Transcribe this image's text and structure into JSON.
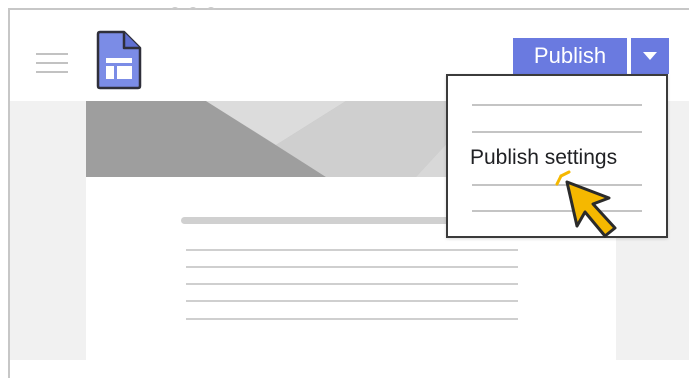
{
  "toolbar": {
    "publish_label": "Publish",
    "menu_icon": "hamburger-menu-icon",
    "doc_icon": "sites-document-icon",
    "dropdown_icon": "caret-down-icon"
  },
  "publish_menu": {
    "items": [
      {
        "label": "Publish settings"
      }
    ]
  },
  "colors": {
    "accent": "#6a7ae0",
    "doc_icon_fill": "#7b8ce6",
    "cursor_fill": "#f5b800",
    "canvas_bg": "#f1f1f1"
  }
}
